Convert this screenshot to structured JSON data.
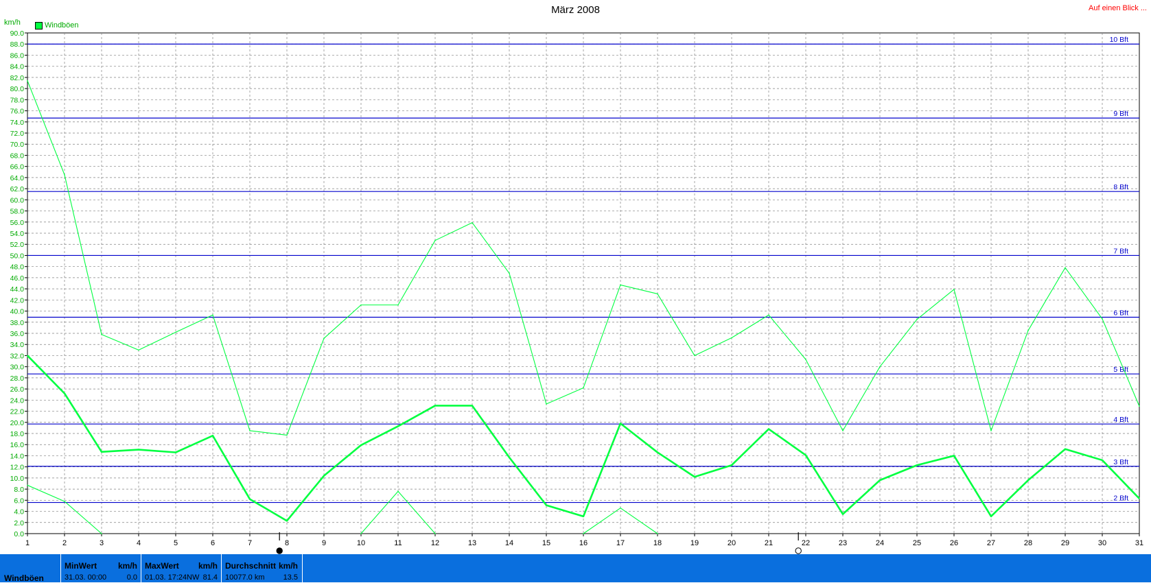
{
  "header": {
    "title": "März 2008",
    "link": "Auf einen Blick ..."
  },
  "chart_data": {
    "type": "line",
    "title": "März 2008",
    "ylabel": "km/h",
    "ylim": [
      0,
      90
    ],
    "y_tick_step": 2,
    "x": [
      1,
      2,
      3,
      4,
      5,
      6,
      7,
      8,
      9,
      10,
      11,
      12,
      13,
      14,
      15,
      16,
      17,
      18,
      19,
      20,
      21,
      22,
      23,
      24,
      25,
      26,
      27,
      28,
      29,
      30,
      31
    ],
    "grid": true,
    "legend": {
      "position": "top-left",
      "entries": [
        "Windböen"
      ]
    },
    "series": [
      {
        "name": "Windböen",
        "role": "max",
        "color": "#00ff40",
        "values": [
          81.4,
          64.5,
          35.8,
          33.0,
          36.2,
          39.3,
          18.5,
          17.7,
          35.1,
          41.1,
          41.1,
          52.7,
          55.9,
          46.8,
          23.3,
          26.2,
          44.7,
          43.1,
          32.0,
          35.2,
          39.3,
          31.3,
          18.5,
          30.0,
          38.5,
          43.9,
          18.5,
          36.5,
          47.8,
          38.6,
          22.9
        ]
      },
      {
        "name": "Windböen",
        "role": "average",
        "color": "#00ff40",
        "values": [
          32.0,
          25.2,
          14.7,
          15.1,
          14.6,
          17.6,
          6.2,
          2.3,
          10.4,
          15.9,
          19.3,
          23.0,
          23.0,
          13.7,
          5.1,
          3.1,
          19.8,
          14.6,
          10.2,
          12.3,
          18.8,
          14.1,
          3.5,
          9.6,
          12.3,
          14.0,
          3.1,
          9.6,
          15.2,
          13.2,
          6.3
        ]
      },
      {
        "name": "Windböen",
        "role": "min",
        "color": "#00ff40",
        "values": [
          8.7,
          5.8,
          0.0,
          null,
          null,
          null,
          null,
          null,
          null,
          0.0,
          7.6,
          0.0,
          null,
          null,
          null,
          0.0,
          4.6,
          0.0,
          null,
          null,
          null,
          null,
          null,
          null,
          null,
          null,
          null,
          null,
          null,
          null,
          null
        ]
      }
    ],
    "reference_lines": [
      {
        "label": "10 Bft",
        "value": 88.0
      },
      {
        "label": "9 Bft",
        "value": 74.7
      },
      {
        "label": "8 Bft",
        "value": 61.5
      },
      {
        "label": "7 Bft",
        "value": 50.0
      },
      {
        "label": "6 Bft",
        "value": 38.9
      },
      {
        "label": "5 Bft",
        "value": 28.7
      },
      {
        "label": "4 Bft",
        "value": 19.7
      },
      {
        "label": "3 Bft",
        "value": 12.1
      },
      {
        "label": "2 Bft",
        "value": 5.6
      }
    ],
    "moon_markers": [
      {
        "day": 7.8,
        "phase": "new-moon"
      },
      {
        "day": 21.8,
        "phase": "full-moon"
      }
    ],
    "colors": {
      "series": "#00ff40",
      "axis_labels": "#00aa00",
      "reference": "#0000cc",
      "grid": "#808080"
    }
  },
  "footer": {
    "row_label": "Windböen",
    "min": {
      "header": "MinWert",
      "unit": "km/h",
      "date": "31.03.  00:00",
      "value": "0.0"
    },
    "max": {
      "header": "MaxWert",
      "unit": "km/h",
      "date": "01.03.  17:24",
      "dir": "NW",
      "value": "81.4"
    },
    "avg": {
      "header": "Durchschnitt",
      "unit": "km/h",
      "distance": "10077.0 km",
      "value": "13.5"
    }
  }
}
